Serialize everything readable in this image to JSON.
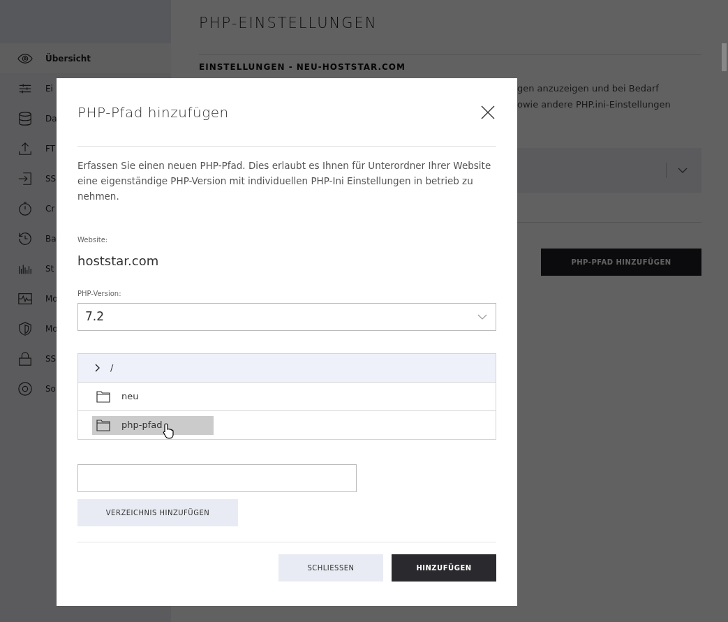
{
  "sidebar": {
    "items": [
      {
        "label": "Übersicht",
        "selected": true
      },
      {
        "label": "Ei",
        "selected": false
      },
      {
        "label": "Da",
        "selected": false
      },
      {
        "label": "FT",
        "selected": false
      },
      {
        "label": "SS",
        "selected": false
      },
      {
        "label": "Cr",
        "selected": false
      },
      {
        "label": "Ba",
        "selected": false
      },
      {
        "label": "St",
        "selected": false
      },
      {
        "label": "Mo",
        "selected": false
      },
      {
        "label": "Mo",
        "selected": false
      },
      {
        "label": "SS",
        "selected": false
      },
      {
        "label": "So",
        "selected": false
      }
    ]
  },
  "page": {
    "title": "PHP-EINSTELLUNGEN",
    "section_heading": "EINSTELLUNGEN - NEU-HOSTSTAR.COM",
    "description_lines": [
      "gen anzuzeigen und bei Bedarf",
      "owie andere PHP.ini-Einstellungen"
    ],
    "add_button": "PHP-PFAD HINZUFÜGEN"
  },
  "dialog": {
    "title": "PHP-Pfad hinzufügen",
    "description": "Erfassen Sie einen neuen PHP-Pfad. Dies erlaubt es Ihnen für Unterordner Ihrer Website eine eigenständige PHP-Version mit individuellen PHP-Ini Einstellungen in betrieb zu nehmen.",
    "website_label": "Website:",
    "website": "hoststar.com",
    "version_label": "PHP-Version:",
    "version": "7.2",
    "tree": {
      "label": "/",
      "selected": true,
      "children": [
        {
          "label": "neu",
          "hovered": false
        },
        {
          "label": "php-pfad",
          "hovered": true
        }
      ]
    },
    "directory_button": "VERZEICHNIS HINZUFÜGEN",
    "buttons": [
      {
        "label": "SCHLIESSEN",
        "kind": "secondary"
      },
      {
        "label": "HINZUFÜGEN",
        "kind": "primary"
      }
    ]
  }
}
